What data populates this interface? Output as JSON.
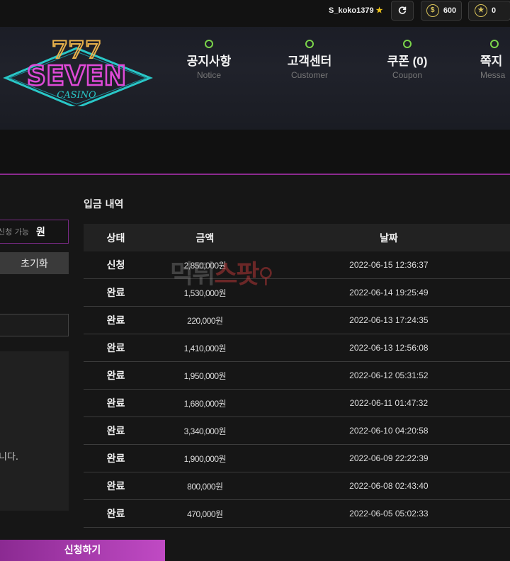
{
  "header": {
    "username": "S_koko1379",
    "money": "600",
    "points": "0",
    "colors": {
      "accent": "#8c2a8f",
      "nav_dot": "#7bd44a",
      "coin": "#d9c35a"
    }
  },
  "logo": {
    "numbers": "777",
    "brand": "SEVEN",
    "sub": "CASINO"
  },
  "nav": [
    {
      "ko": "공지사항",
      "en": "Notice"
    },
    {
      "ko": "고객센터",
      "en": "Customer"
    },
    {
      "ko": "쿠폰 (0)",
      "en": "Coupon"
    },
    {
      "ko": "쪽지",
      "en": "Messa"
    }
  ],
  "left_panel": {
    "input_text": "신청 가능",
    "won": "원",
    "reset_label": "초기화",
    "notice_fragment": "니다.",
    "submit_label": "신청하기"
  },
  "history": {
    "title": "입금 내역",
    "columns": [
      "상태",
      "금액",
      "날짜"
    ],
    "rows": [
      {
        "status": "신청",
        "amount": "2,850,000원",
        "date": "2022-06-15 12:36:37"
      },
      {
        "status": "완료",
        "amount": "1,530,000원",
        "date": "2022-06-14 19:25:49"
      },
      {
        "status": "완료",
        "amount": "220,000원",
        "date": "2022-06-13 17:24:35"
      },
      {
        "status": "완료",
        "amount": "1,410,000원",
        "date": "2022-06-13 12:56:08"
      },
      {
        "status": "완료",
        "amount": "1,950,000원",
        "date": "2022-06-12 05:31:52"
      },
      {
        "status": "완료",
        "amount": "1,680,000원",
        "date": "2022-06-11 01:47:32"
      },
      {
        "status": "완료",
        "amount": "3,340,000원",
        "date": "2022-06-10 04:20:58"
      },
      {
        "status": "완료",
        "amount": "1,900,000원",
        "date": "2022-06-09 22:22:39"
      },
      {
        "status": "완료",
        "amount": "800,000원",
        "date": "2022-06-08 02:43:40"
      },
      {
        "status": "완료",
        "amount": "470,000원",
        "date": "2022-06-05 05:02:33"
      }
    ]
  },
  "watermark": {
    "part1": "먹튀",
    "part2": "스팟"
  }
}
